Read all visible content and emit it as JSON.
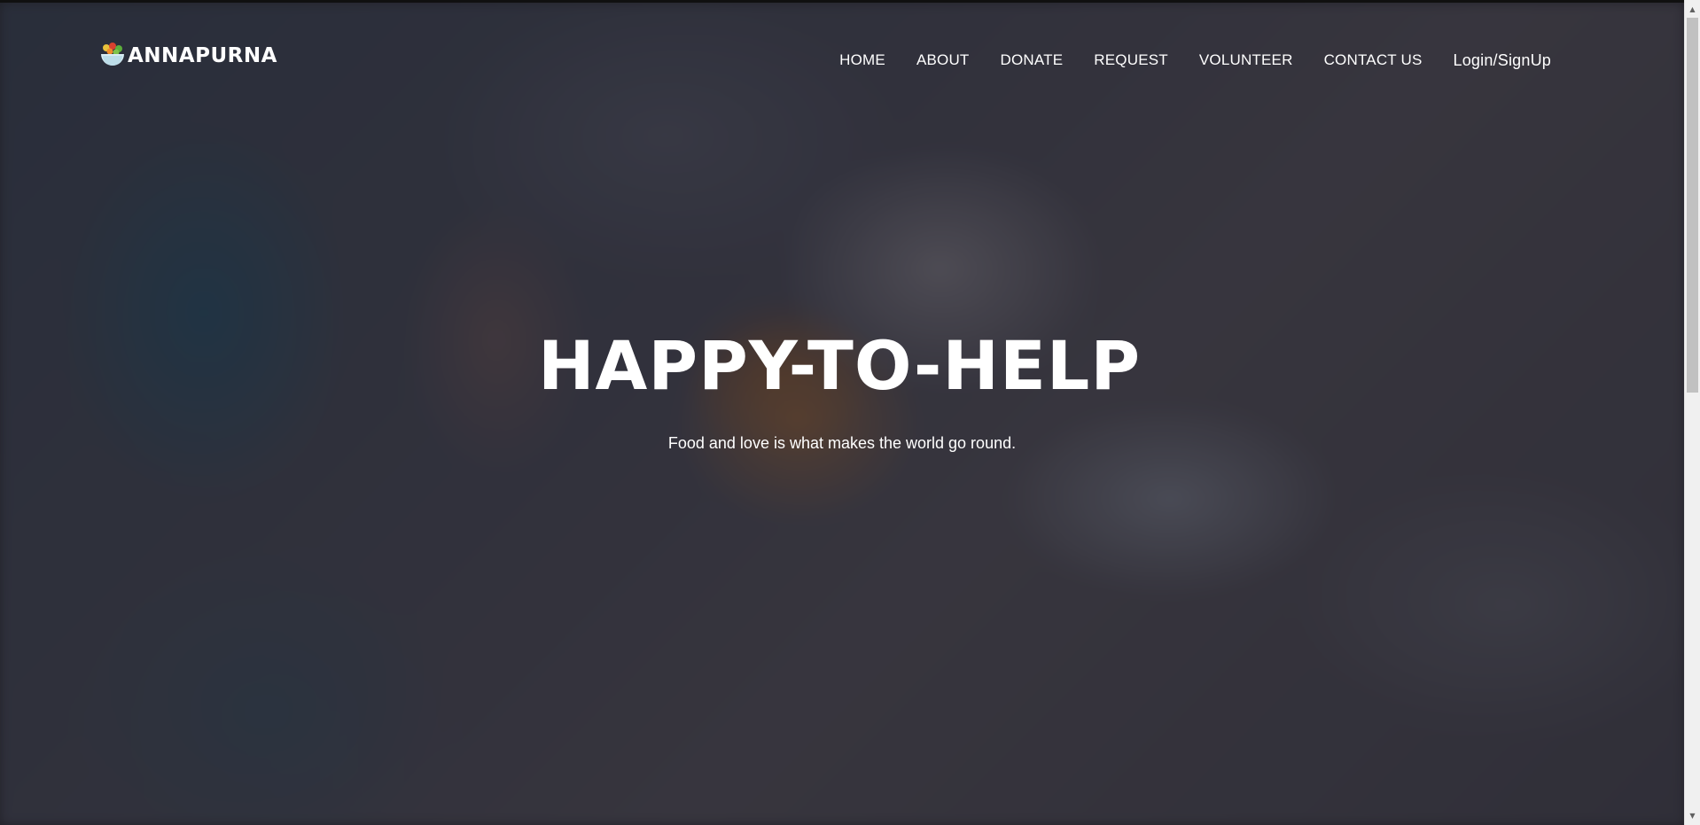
{
  "brand": {
    "name": "ANNAPURNA",
    "logo_icon": "food-bowl-icon"
  },
  "nav": {
    "items": [
      {
        "label": "HOME"
      },
      {
        "label": "ABOUT"
      },
      {
        "label": "DONATE"
      },
      {
        "label": "REQUEST"
      },
      {
        "label": "VOLUNTEER"
      },
      {
        "label": "CONTACT US"
      },
      {
        "label": "Login/SignUp"
      }
    ]
  },
  "hero": {
    "title": "HAPPY-TO-HELP",
    "subtitle": "Food and love is what makes the world go round.",
    "background_icon": "hands-sharing-bread-photo"
  },
  "scrollbar": {
    "up_icon": "scroll-up-arrow-icon",
    "down_icon": "scroll-down-arrow-icon"
  },
  "colors": {
    "text": "#ffffff",
    "overlay": "#28263080",
    "scrollbar_track": "#f0f0f0",
    "scrollbar_thumb": "#c1c1c1"
  }
}
